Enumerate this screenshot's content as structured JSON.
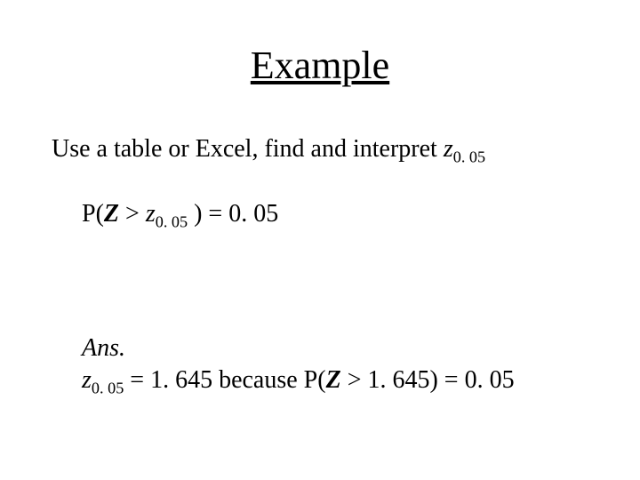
{
  "title": "Example",
  "prompt": {
    "pre": "Use a table or Excel, find and interpret ",
    "z": "z",
    "zsub": "0. 05"
  },
  "equation": {
    "p_open": "P(",
    "Z": "Z",
    "gt": " > ",
    "z": "z",
    "zsub": "0. 05",
    "rest": " ) = 0. 05"
  },
  "answer": {
    "label": "Ans.",
    "z": "z",
    "zsub": "0. 05",
    "eq": " = 1. 645  because  P(",
    "Z": "Z",
    "tail": " > 1. 645) = 0. 05"
  }
}
